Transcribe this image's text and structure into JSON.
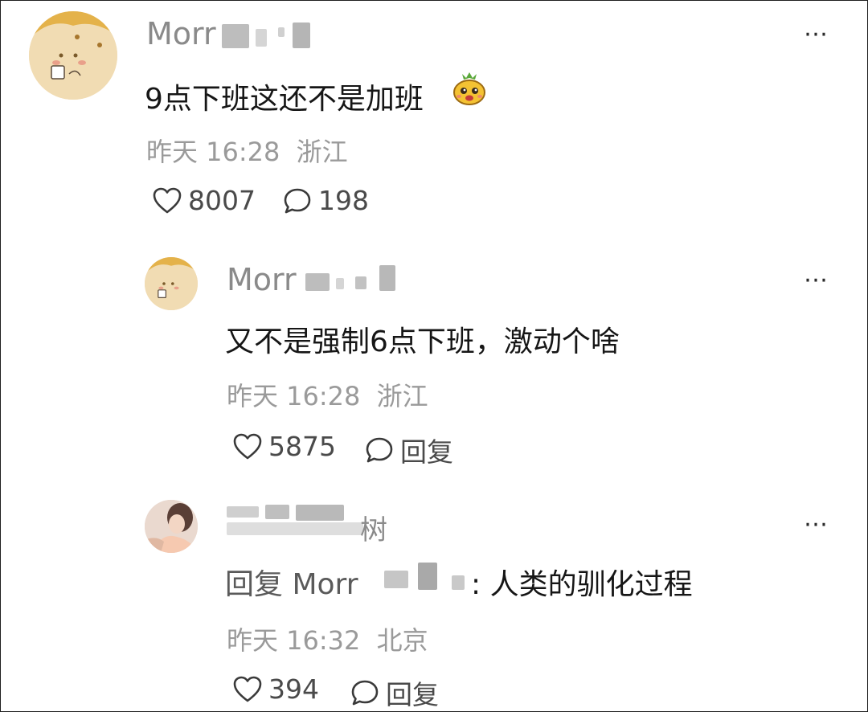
{
  "comments": [
    {
      "username": "Morr",
      "text": "9点下班这还不是加班",
      "emoji": "pineapple-face-emoji",
      "time": "昨天 16:28",
      "location": "浙江",
      "likes": "8007",
      "replies": "198",
      "more_label": "⋯"
    },
    {
      "username": "Morr",
      "text": "又不是强制6点下班，激动个啥",
      "time": "昨天 16:28",
      "location": "浙江",
      "likes": "5875",
      "reply_label": "回复",
      "more_label": "⋯"
    },
    {
      "username_tail": "树",
      "reply_prefix": "回复 Morr",
      "text": ": 人类的驯化过程",
      "time": "昨天 16:32",
      "location": "北京",
      "likes": "394",
      "reply_label": "回复",
      "more_label": "⋯"
    }
  ],
  "colors": {
    "text": "#161616",
    "meta": "#9a9a9a",
    "username": "#8a8a8a",
    "icon": "#3a3a3a"
  }
}
